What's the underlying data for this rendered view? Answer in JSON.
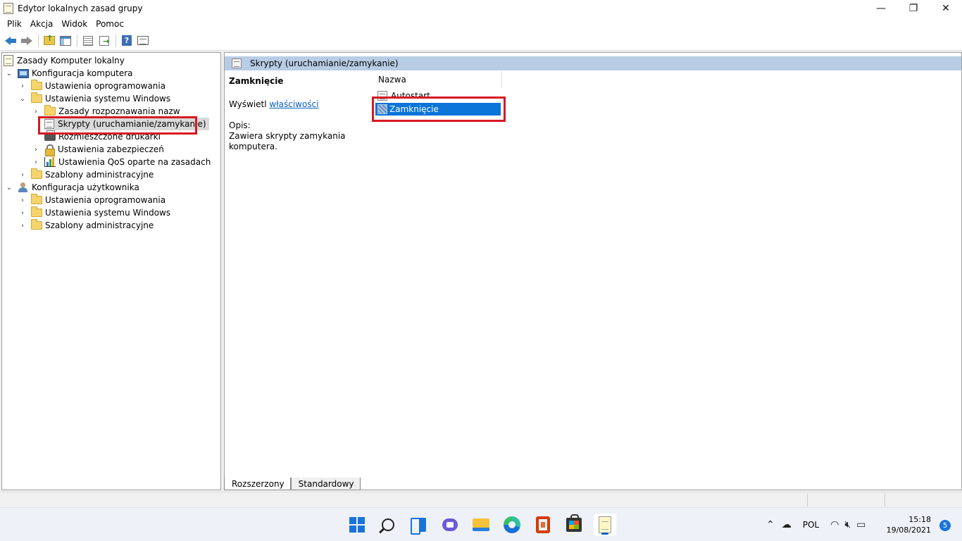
{
  "window": {
    "title": "Edytor lokalnych zasad grupy",
    "minimize": "—",
    "maximize": "❐",
    "close": "✕"
  },
  "menu": [
    "Plik",
    "Akcja",
    "Widok",
    "Pomoc"
  ],
  "toolbar": {
    "buttons": [
      "back",
      "forward",
      "up-folder",
      "show-hide-tree",
      "list",
      "export-list",
      "help",
      "properties"
    ]
  },
  "tree": {
    "root": "Zasady Komputer lokalny",
    "computer_config": "Konfiguracja komputera",
    "cc_software": "Ustawienia oprogramowania",
    "cc_windows": "Ustawienia systemu Windows",
    "name_resolution": "Zasady rozpoznawania nazw",
    "scripts": "Skrypty (uruchamianie/zamykanie)",
    "printers": "Rozmieszczone drukarki",
    "security": "Ustawienia zabezpieczeń",
    "qos": "Ustawienia QoS oparte na zasadach",
    "cc_admin_templates": "Szablony administracyjne",
    "user_config": "Konfiguracja użytkownika",
    "uc_software": "Ustawienia oprogramowania",
    "uc_windows": "Ustawienia systemu Windows",
    "uc_admin_templates": "Szablony administracyjne"
  },
  "right": {
    "header": "Skrypty (uruchamianie/zamykanie)",
    "detail_title": "Zamknięcie",
    "show_prefix": "Wyświetl",
    "show_link": "właściwości",
    "desc_label": "Opis:",
    "desc_line1": "Zawiera skrypty zamykania",
    "desc_line2": "komputera.",
    "column_name": "Nazwa",
    "items": [
      "Autostart",
      "Zamknięcie"
    ],
    "selected_item": "Zamknięcie"
  },
  "tabs": [
    "Rozszerzony",
    "Standardowy"
  ],
  "taskbar": {
    "apps": [
      "start",
      "search",
      "task-view",
      "chat",
      "file-explorer",
      "edge",
      "office",
      "store",
      "notepad"
    ],
    "active_app": "notepad"
  },
  "tray": {
    "language": "POL",
    "time": "15:18",
    "date": "19/08/2021",
    "notifications": "5"
  },
  "colors": {
    "highlight_border": "#d71920",
    "selection": "#0b74d8",
    "header_bg": "#b8cde5"
  }
}
